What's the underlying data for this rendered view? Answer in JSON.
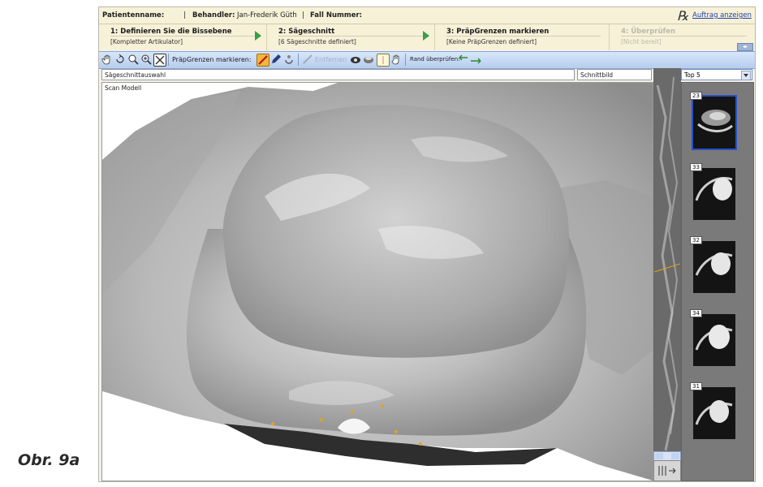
{
  "header": {
    "patient_label": "Patientenname:",
    "doctor_label": "Behandler:",
    "doctor_value": "Jan-Frederik Güth",
    "case_label": "Fall Nummer:",
    "rx_symbol": "℞",
    "order_link": "Auftrag anzeigen"
  },
  "steps": [
    {
      "title": "1: Definieren Sie die Bissebene",
      "subtitle": "[Kompletter Artikulator]"
    },
    {
      "title": "2: Sägeschnitt",
      "subtitle": "[6 Sägeschnitte definiert]"
    },
    {
      "title": "3: PräpGrenzen markieren",
      "subtitle": "[Keine PräpGrenzen definiert]"
    },
    {
      "title": "4: Überprüfen",
      "subtitle": "[Nicht bereit]"
    }
  ],
  "toolbar": {
    "marks_label": "PräpGrenzen markieren:",
    "remove_label": "Entfernen",
    "edge_label": "Rand überprüfen:"
  },
  "fields": {
    "section_select": "Sägeschnittauswahl",
    "cross_section": "Schnittbild",
    "top_select": "Top 5"
  },
  "viewport": {
    "label": "Scan Modell"
  },
  "thumbnails": [
    "23",
    "33",
    "32",
    "34",
    "31"
  ],
  "caption": "Obr. 9a",
  "colors": {
    "header_bg": "#f7f1d8",
    "toolbar_bg": "#c7d9f3",
    "step_arrow": "#3aa043",
    "selection": "#2c4fc8",
    "margin_dot": "#e6a21c"
  }
}
